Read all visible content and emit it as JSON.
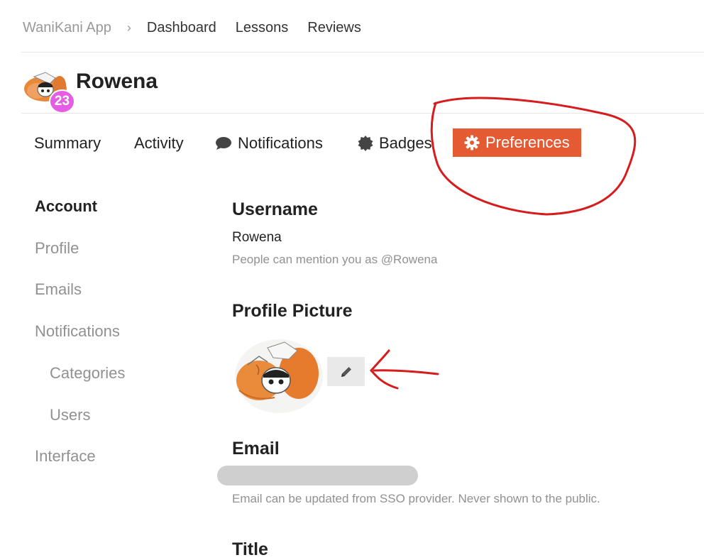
{
  "nav": {
    "brand": "WaniKani App",
    "separator": "›",
    "links": [
      "Dashboard",
      "Lessons",
      "Reviews"
    ]
  },
  "user": {
    "name": "Rowena",
    "level": "23"
  },
  "tabs": {
    "summary": "Summary",
    "activity": "Activity",
    "notifications": "Notifications",
    "badges": "Badges",
    "preferences": "Preferences",
    "active": "Preferences"
  },
  "sidebar": {
    "account": "Account",
    "profile": "Profile",
    "emails": "Emails",
    "notifications": "Notifications",
    "categories": "Categories",
    "users": "Users",
    "interface": "Interface",
    "active": "Account"
  },
  "main": {
    "username_heading": "Username",
    "username_value": "Rowena",
    "username_help": "People can mention you as @Rowena",
    "picture_heading": "Profile Picture",
    "email_heading": "Email",
    "email_help": "Email can be updated from SSO provider. Never shown to the public.",
    "title_heading": "Title"
  },
  "colors": {
    "accent": "#e45a33",
    "level_badge": "#e45de4",
    "annotation": "#d61c1c",
    "muted_text": "#919191"
  },
  "icons": {
    "notifications_tab": "speech-bubble-icon",
    "badges_tab": "badge-seal-icon",
    "preferences_tab": "gear-icon",
    "edit_picture": "pencil-icon"
  }
}
